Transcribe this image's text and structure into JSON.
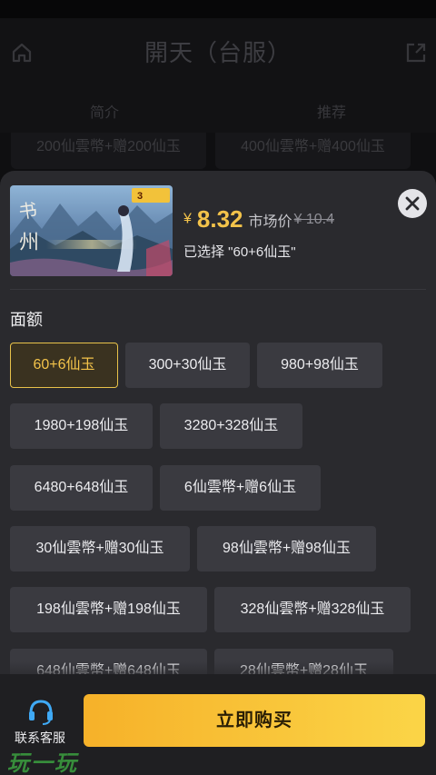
{
  "header": {
    "title": "開天（台服）",
    "home_icon": "home-icon",
    "share_icon": "share-icon"
  },
  "tabs": [
    {
      "label": "简介"
    },
    {
      "label": "推荐"
    }
  ],
  "background_items": [
    "200仙雲幣+赠200仙玉",
    "400仙雲幣+赠400仙玉"
  ],
  "product": {
    "currency": "¥",
    "price": "8.32",
    "market_label": "市场价",
    "market_price": "¥ 10.4",
    "selected_text": "已选择 \"60+6仙玉\""
  },
  "section": {
    "label": "面额"
  },
  "options": [
    {
      "label": "60+6仙玉",
      "selected": true
    },
    {
      "label": "300+30仙玉",
      "selected": false
    },
    {
      "label": "980+98仙玉",
      "selected": false
    },
    {
      "label": "1980+198仙玉",
      "selected": false
    },
    {
      "label": "3280+328仙玉",
      "selected": false
    },
    {
      "label": "6480+648仙玉",
      "selected": false
    },
    {
      "label": "6仙雲幣+赠6仙玉",
      "selected": false
    },
    {
      "label": "30仙雲幣+赠30仙玉",
      "selected": false
    },
    {
      "label": "98仙雲幣+赠98仙玉",
      "selected": false
    },
    {
      "label": "198仙雲幣+赠198仙玉",
      "selected": false
    },
    {
      "label": "328仙雲幣+赠328仙玉",
      "selected": false
    },
    {
      "label": "648仙雲幣+赠648仙玉",
      "selected": false
    },
    {
      "label": "28仙雲幣+赠28仙玉",
      "selected": false
    }
  ],
  "bottom": {
    "support_label": "联系客服",
    "buy_label": "立即购买",
    "watermark": "玩一玩"
  },
  "colors": {
    "accent": "#f3c34a",
    "sheet_bg": "#2a2a2e",
    "chip_bg": "#3a3a40",
    "buy_gradient_start": "#f6b129",
    "buy_gradient_end": "#fbd547",
    "support_icon": "#3fa9f5"
  }
}
